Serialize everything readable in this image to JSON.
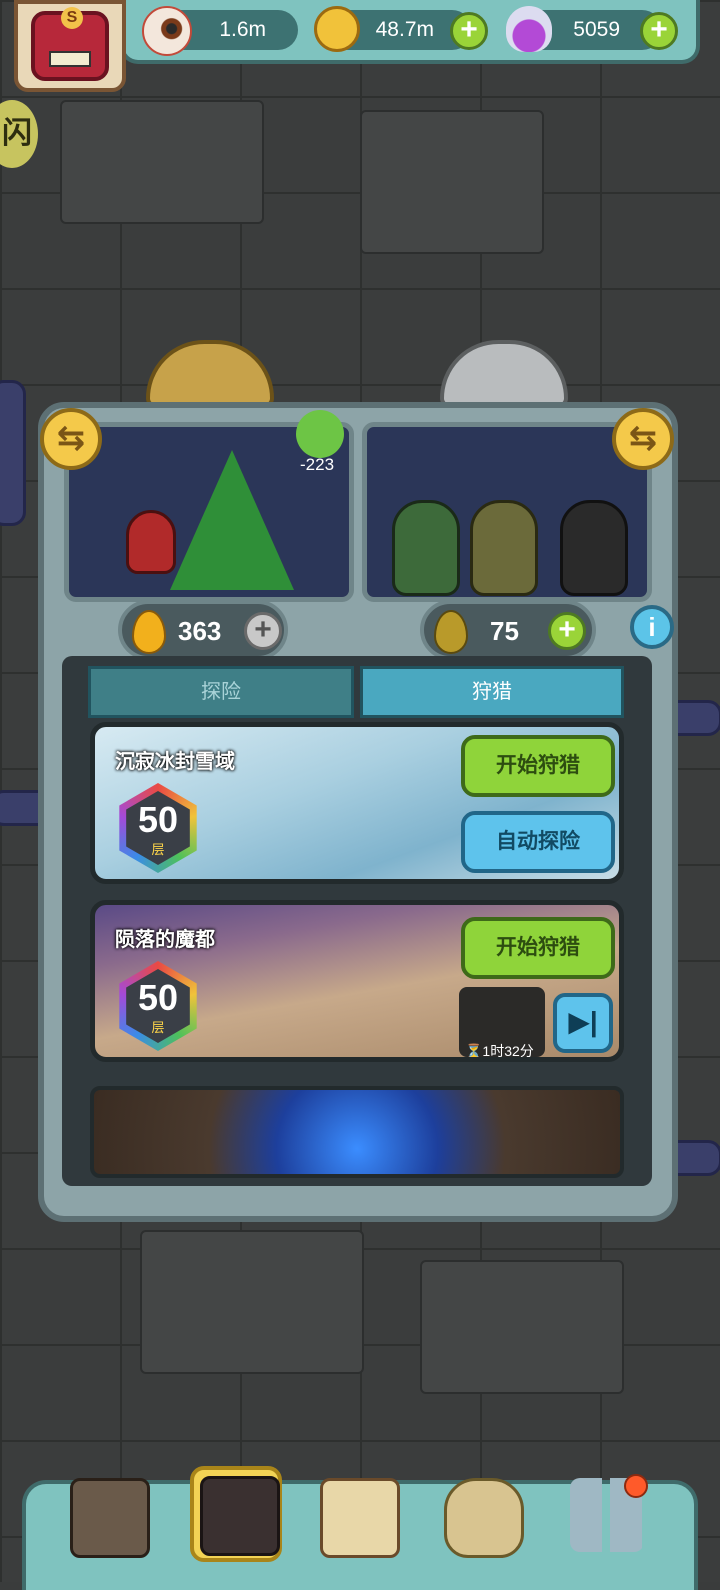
{
  "resources": {
    "eyeball": {
      "value": "1.6m",
      "icon": "eyeball-icon"
    },
    "gold": {
      "value": "48.7m",
      "icon": "gold-coin-icon"
    },
    "potion": {
      "value": "5059",
      "icon": "purple-potion-icon"
    }
  },
  "avatar": {
    "badge": "S"
  },
  "left_badge": "闪",
  "clover": {
    "count": "-223"
  },
  "drops": {
    "left": "363",
    "right": "75"
  },
  "tabs": [
    {
      "label": "探险"
    },
    {
      "label": "狩猎"
    }
  ],
  "cards": [
    {
      "title": "沉寂冰封雪域",
      "level": "50",
      "level_unit": "层",
      "primary_button": "开始狩猎",
      "secondary_button": "自动探险"
    },
    {
      "title": "陨落的魔都",
      "level": "50",
      "level_unit": "层",
      "primary_button": "开始狩猎",
      "timer": "⏳1时32分"
    }
  ],
  "nav": [
    {
      "name": "shop-icon"
    },
    {
      "name": "monster-lair-icon"
    },
    {
      "name": "book-icon"
    },
    {
      "name": "money-bag-icon"
    },
    {
      "name": "grid-menu-icon"
    }
  ],
  "colors": {
    "accent_green": "#8fd43a",
    "accent_blue": "#5ec3ec",
    "teal_bar": "#7fc3bf"
  }
}
